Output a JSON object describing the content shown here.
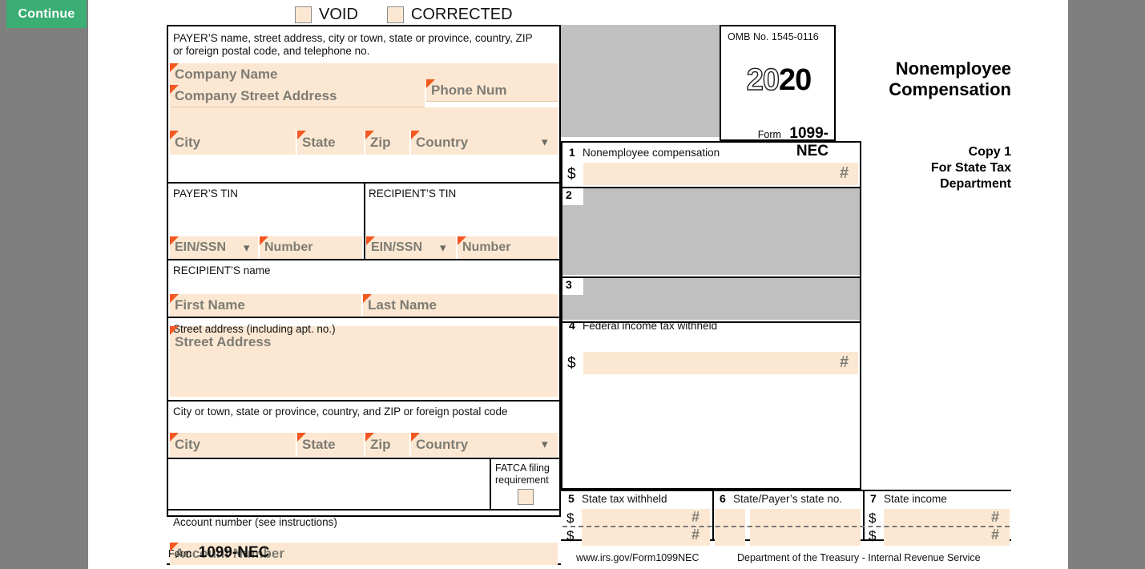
{
  "toolbar": {
    "continue_label": "Continue"
  },
  "top_checkboxes": [
    {
      "name": "void",
      "label": "VOID",
      "checked": false
    },
    {
      "name": "corrected",
      "label": "CORRECTED",
      "checked": false
    }
  ],
  "form": {
    "payer_block": {
      "instruction_line1": "PAYER’S name, street address, city or town, state or province, country, ZIP",
      "instruction_line2": "or foreign postal code, and telephone no.",
      "fields": {
        "company_name": {
          "placeholder": "Company Name",
          "value": ""
        },
        "company_street": {
          "placeholder": "Company Street Address",
          "value": ""
        },
        "phone": {
          "placeholder": "Phone Num",
          "value": ""
        },
        "city": {
          "placeholder": "City",
          "value": ""
        },
        "state": {
          "placeholder": "State",
          "value": ""
        },
        "zip": {
          "placeholder": "Zip",
          "value": ""
        },
        "country": {
          "placeholder": "Country",
          "value": ""
        }
      }
    },
    "omb": {
      "omb_no": "OMB No. 1545-0116",
      "year_hollow": "20",
      "year_solid": "20",
      "form_label": "Form",
      "form_number": "1099-NEC"
    },
    "title": {
      "line1": "Nonemployee",
      "line2": "Compensation"
    },
    "copy": {
      "line1": "Copy 1",
      "line2": "For State Tax",
      "line3": "Department"
    },
    "payer_tin": {
      "label": "PAYER’S TIN",
      "type_placeholder": "EIN/SSN",
      "number_placeholder": "Number",
      "type_value": "",
      "number_value": ""
    },
    "recipient_tin": {
      "label": "RECIPIENT’S TIN",
      "type_placeholder": "EIN/SSN",
      "number_placeholder": "Number",
      "type_value": "",
      "number_value": ""
    },
    "recipient_name": {
      "label": "RECIPIENT’S name",
      "first_placeholder": "First Name",
      "last_placeholder": "Last Name",
      "first_value": "",
      "last_value": ""
    },
    "recipient_street": {
      "label": "Street address (including apt. no.)",
      "placeholder": "Street Address",
      "value": ""
    },
    "recipient_city_block": {
      "label": "City or town, state or province, country, and ZIP or foreign postal code",
      "city_placeholder": "City",
      "state_placeholder": "State",
      "zip_placeholder": "Zip",
      "country_placeholder": "Country",
      "city_value": "",
      "state_value": "",
      "zip_value": "",
      "country_value": ""
    },
    "fatca": {
      "label_line1": "FATCA filing",
      "label_line2": "requirement",
      "checked": false
    },
    "account_number": {
      "label": "Account number (see instructions)",
      "placeholder": "Account Number",
      "value": ""
    },
    "box1": {
      "num": "1",
      "label": "Nonemployee compensation",
      "currency": "$",
      "marker": "#",
      "value": ""
    },
    "box2": {
      "num": "2",
      "label": ""
    },
    "box3": {
      "num": "3",
      "label": ""
    },
    "box4": {
      "num": "4",
      "label": "Federal income tax withheld",
      "currency": "$",
      "marker": "#",
      "value": ""
    },
    "box5": {
      "num": "5",
      "label": "State tax withheld",
      "currency": "$",
      "marker": "#",
      "row1_value": "",
      "row2_value": ""
    },
    "box6": {
      "num": "6",
      "label": "State/Payer’s state no.",
      "row1_state_value": "",
      "row1_number_value": "",
      "row2_state_value": "",
      "row2_number_value": ""
    },
    "box7": {
      "num": "7",
      "label": "State income",
      "currency": "$",
      "marker": "#",
      "row1_value": "",
      "row2_value": ""
    },
    "footer": {
      "form_label": "Form",
      "form_number": "1099-NEC",
      "url": "www.irs.gov/Form1099NEC",
      "agency": "Department of the Treasury - Internal Revenue Service"
    }
  },
  "colors": {
    "page_background": "#7f7f7f",
    "sheet": "#ffffff",
    "input_fill": "#fce8d2",
    "input_text": "#7d7c74",
    "required_marker": "#f4571f",
    "disabled_box": "#c0c0c0",
    "accent_green": "#3aae73"
  }
}
